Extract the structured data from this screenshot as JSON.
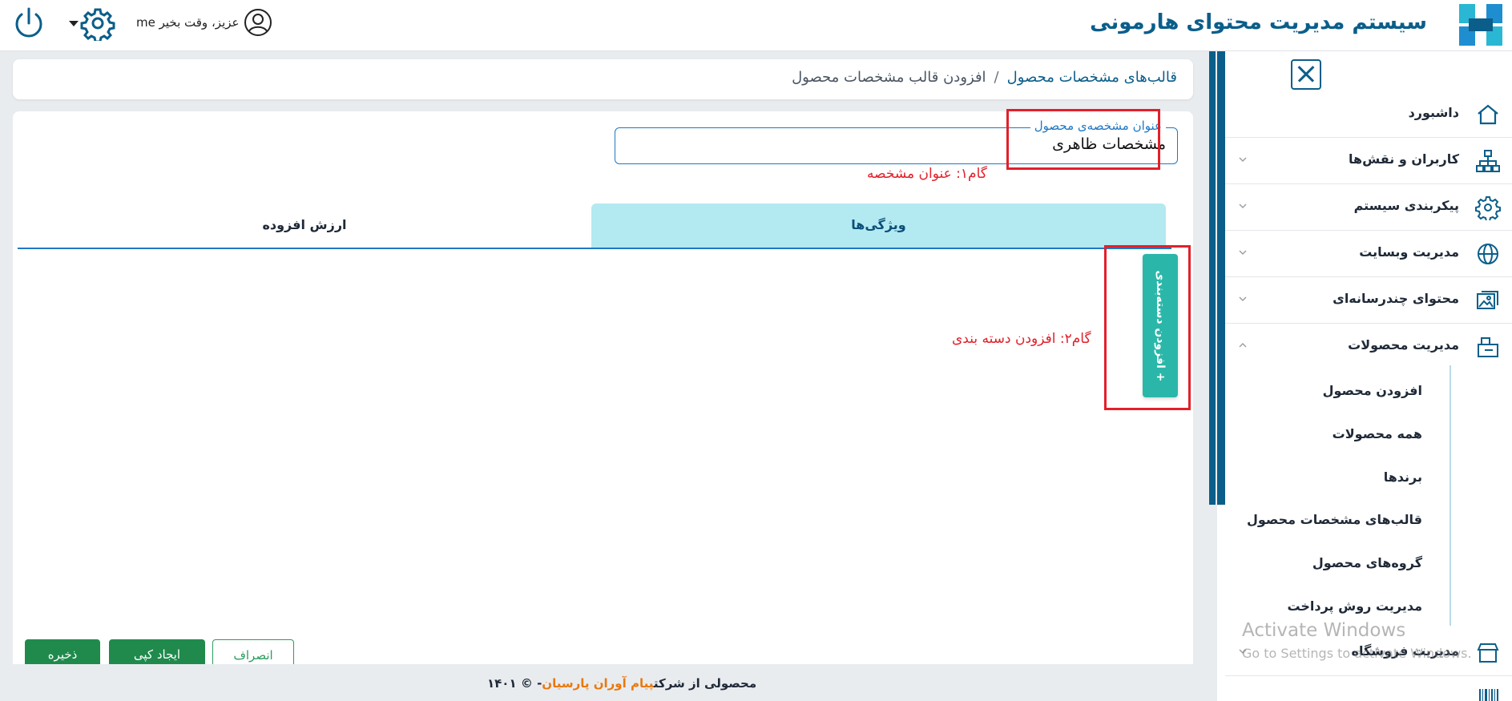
{
  "header": {
    "app_title": "سیستم مدیریت محتوای هارمونی",
    "greeting": "me عزیز، وقت بخیر"
  },
  "breadcrumb": {
    "parent": "قالب‌های مشخصات محصول",
    "separator": "/",
    "current": "افزودن قالب مشخصات محصول"
  },
  "form": {
    "field_label": "عنوان مشخصه‌ی محصول",
    "field_value": "مشخصات ظاهری"
  },
  "annotations": {
    "step1": "گام۱: عنوان مشخصه",
    "step2": "گام۲: افزودن دسته بندی"
  },
  "tabs": [
    {
      "label": "ویژگی‌ها",
      "active": true
    },
    {
      "label": "ارزش افزوده",
      "active": false
    }
  ],
  "add_category_button": "+ افزودن دسته‌بندی",
  "actions": {
    "cancel": "انصراف",
    "copy": "ایجاد کپی",
    "save": "ذخیره"
  },
  "sidebar": {
    "items": [
      {
        "label": "داشبورد",
        "icon": "home-icon"
      },
      {
        "label": "کاربران و نقش‌ها",
        "icon": "org-chart-icon"
      },
      {
        "label": "پیکربندی سیستم",
        "icon": "gear-icon"
      },
      {
        "label": "مدیریت وبسایت",
        "icon": "globe-icon"
      },
      {
        "label": "محتوای چندرسانه‌ای",
        "icon": "images-icon"
      },
      {
        "label": "مدیریت محصولات",
        "icon": "product-box-icon"
      },
      {
        "label": "مدیریت فروشگاه",
        "icon": "store-icon"
      }
    ],
    "sub_items": [
      {
        "label": "افزودن محصول"
      },
      {
        "label": "همه محصولات"
      },
      {
        "label": "برندها"
      },
      {
        "label": "قالب‌های مشخصات محصول"
      },
      {
        "label": "گروه‌های محصول"
      },
      {
        "label": "مدیریت روش پرداخت"
      }
    ]
  },
  "footer": {
    "prefix": "محصولی از شرکت",
    "company": "پیام آوران پارسیان",
    "suffix": "- © ۱۴۰۱"
  },
  "watermark": {
    "title": "Activate Windows",
    "subtitle": "Go to Settings to activate Windows."
  },
  "colors": {
    "brand": "#0b5e8a",
    "link": "#1f78c4",
    "tab_active_bg": "#b3e9f1",
    "teal_button": "#2ab7a9",
    "green_button": "#1f8a4c",
    "annotation_red": "#e2202a",
    "footer_company": "#e8790f"
  }
}
